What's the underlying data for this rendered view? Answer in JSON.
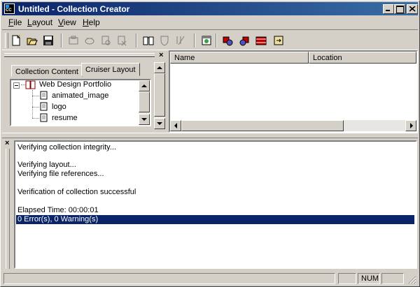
{
  "window": {
    "title": "Untitled - Collection Creator",
    "app_icon_text": "CC"
  },
  "menu": {
    "items": [
      {
        "label": "File",
        "mnemonic": "F",
        "rest": "ile"
      },
      {
        "label": "Layout",
        "mnemonic": "L",
        "rest": "ayout"
      },
      {
        "label": "View",
        "mnemonic": "V",
        "rest": "iew"
      },
      {
        "label": "Help",
        "mnemonic": "H",
        "rest": "elp"
      }
    ]
  },
  "toolbar": {
    "buttons": [
      "new-icon",
      "open-icon",
      "save-icon",
      "tool-1-icon",
      "tool-2-icon",
      "tool-3-icon",
      "tool-4-icon",
      "book-icon",
      "shield-icon",
      "tool-5-icon",
      "browser-icon",
      "gear-red-icon",
      "gear-blue-icon",
      "film-icon",
      "export-icon"
    ]
  },
  "left_pane": {
    "tabs": [
      "Collection Content",
      "Cruiser Layout"
    ],
    "active_tab": "Cruiser Layout",
    "tree": {
      "root": "Web Design Portfolio",
      "children": [
        "animated_image",
        "logo",
        "resume"
      ]
    }
  },
  "list_view": {
    "columns": [
      "Name",
      "Location"
    ]
  },
  "output": {
    "lines": [
      "Verifying collection integrity...",
      "",
      "Verifying layout...",
      "Verifying file references...",
      "",
      "Verification of collection successful",
      "",
      "Elapsed Time: 00:00:01",
      "0 Error(s), 0 Warning(s)"
    ],
    "selected_line": "0 Error(s), 0 Warning(s)"
  },
  "status": {
    "num": "NUM"
  },
  "colors": {
    "title_start": "#0a246a",
    "title_end": "#3a6ea5",
    "selection": "#0a246a",
    "face": "#d4d0c8"
  }
}
